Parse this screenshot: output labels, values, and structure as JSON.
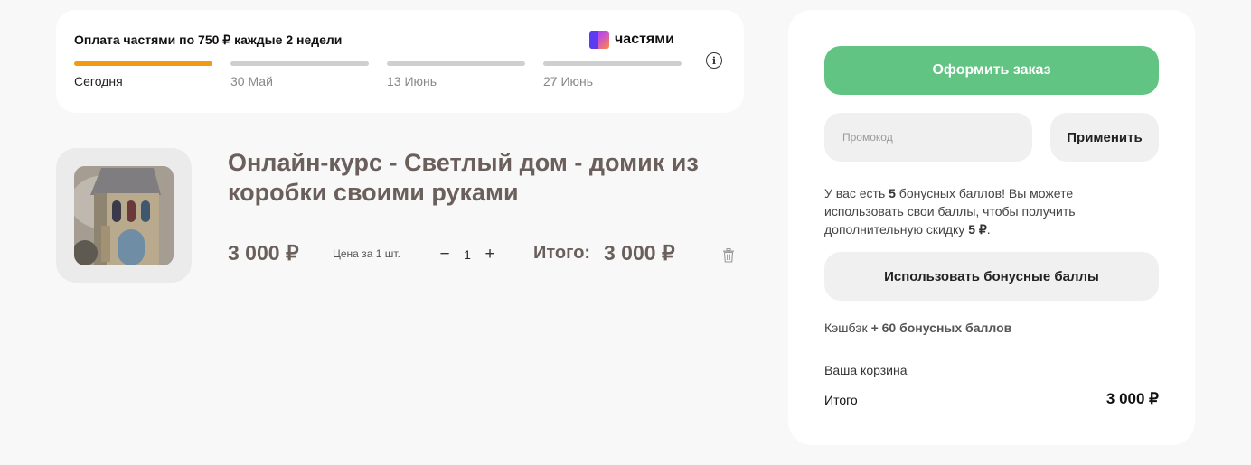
{
  "installments": {
    "title": "Оплата частями по 750 ₽ каждые 2 недели",
    "brand_name": "частями",
    "info_icon": "info-icon",
    "payments": [
      {
        "date": "Сегодня",
        "active": true
      },
      {
        "date": "30 Май",
        "active": false
      },
      {
        "date": "13 Июнь",
        "active": false
      },
      {
        "date": "27 Июнь",
        "active": false
      }
    ],
    "colors": {
      "active": "#f29a12",
      "inactive": "#cfcfcf"
    }
  },
  "product": {
    "title": "Онлайн-курс - Светлый дом - домик из коробки своими руками",
    "price": "3 000 ₽",
    "price_note": "Цена за 1 шт.",
    "quantity": "1",
    "decrease_symbol": "−",
    "increase_symbol": "+",
    "total_label": "Итого:",
    "total_value": "3 000 ₽",
    "delete_icon": "trash-icon"
  },
  "summary": {
    "checkout_label": "Оформить заказ",
    "checkout_color": "#62c482",
    "promo_placeholder": "Промокод",
    "apply_label": "Применить",
    "bonus_prefix": "У вас есть ",
    "bonus_points": "5",
    "bonus_middle": " бонусных баллов! Вы можете использовать свои баллы, чтобы получить дополнительную скидку ",
    "bonus_discount": "5 ₽",
    "bonus_suffix": ".",
    "use_bonus_label": "Использовать бонусные баллы",
    "cashback_label": "Кэшбэк",
    "cashback_value": "+ 60 бонусных баллов",
    "cart_label": "Ваша корзина",
    "itogo_label": "Итого",
    "itogo_value": "3 000 ₽"
  }
}
